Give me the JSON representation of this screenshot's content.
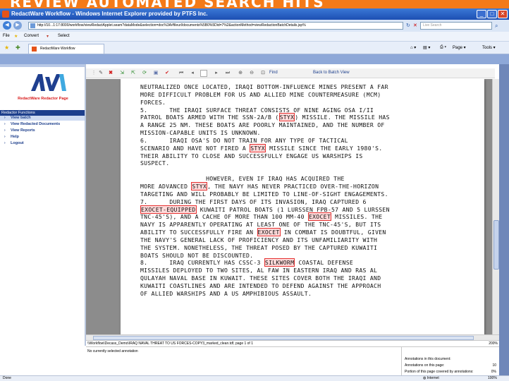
{
  "banner": {
    "text": "REVIEW AUTOMATED SEARCH HITS"
  },
  "window": {
    "title": "RedactWare Workflow - Windows Internet Explorer provided by PTFS Inc."
  },
  "address": {
    "url": "http://10...1:17:8000/workflow/viewRedactApplet.seam?dataMode&selection=doc%3A#fileurl/documents%5B0%5Did=7%2&actionMethod=viewRedactionBatchDetails.jsp%",
    "search_placeholder": "Live Search"
  },
  "menu": {
    "file": "File",
    "star": "★",
    "convert": "Convert",
    "select": "Select"
  },
  "favorites": {
    "tab_label": "RedactWare Workflow",
    "page": "Page",
    "tools": "Tools"
  },
  "sidebar": {
    "brand": "RedactWare Redactor Page",
    "section_title": "Redactor Functions",
    "links": [
      {
        "label": "View batch"
      },
      {
        "label": "View Redacted Documents"
      },
      {
        "label": "View Reports"
      },
      {
        "label": "Help"
      },
      {
        "label": "Logout"
      }
    ]
  },
  "toolbar": {
    "find": "Find",
    "back": "Back to Batch View"
  },
  "document": {
    "lines": [
      [
        {
          "t": "NEUTRALIZED ONCE LOCATED, IRAQI BOTTOM-INFLUENCE MINES PRESENT A FAR"
        }
      ],
      [
        {
          "t": "MORE DIFFICULT PROBLEM FOR US AND ALLIED MINE COUNTERMEASURE (MCM)"
        }
      ],
      [
        {
          "t": "FORCES."
        }
      ],
      [
        {
          "t": "5.      THE IRAQI SURFACE THREAT CONSISTS OF NINE AGING OSA I/II"
        }
      ],
      [
        {
          "t": "PATROL BOATS ARMED WITH THE SSN-2A/B ("
        },
        {
          "t": "STYX",
          "r": 1
        },
        {
          "t": ") MISSILE. THE MISSILE HAS"
        }
      ],
      [
        {
          "t": "A RANGE 25 NM. THESE BOATS ARE POORLY MAINTAINED, AND THE NUMBER OF"
        }
      ],
      [
        {
          "t": "MISSION-CAPABLE UNITS IS UNKNOWN."
        }
      ],
      [
        {
          "t": "6.      IRAQI OSA'S DO NOT TRAIN FOR ANY TYPE OF TACTICAL"
        }
      ],
      [
        {
          "t": "SCENARIO AND HAVE NOT FIRED A "
        },
        {
          "t": "STYX",
          "r": 1
        },
        {
          "t": " MISSILE SINCE THE EARLY 1980'S."
        }
      ],
      [
        {
          "t": "THEIR ABILITY TO CLOSE AND SUCCESSFULLY ENGAGE US WARSHIPS IS"
        }
      ],
      [
        {
          "t": "SUSPECT."
        }
      ],
      [
        {
          "t": ""
        }
      ],
      [
        {
          "t": "                  HOWEVER, EVEN IF IRAQ HAS ACQUIRED THE"
        }
      ],
      [
        {
          "t": "MORE ADVANCED "
        },
        {
          "t": "STYX",
          "r": 1
        },
        {
          "t": ", THE NAVY HAS NEVER PRACTICED OVER-THE-HORIZON"
        }
      ],
      [
        {
          "t": "TARGETING AND WILL PROBABLY BE LIMITED TO LINE-OF-SIGHT ENGAGEMENTS."
        }
      ],
      [
        {
          "t": "7.      DURING THE FIRST DAYS OF ITS INVASION, IRAQ CAPTURED 6"
        }
      ],
      [
        {
          "t": "EXOCET-EQUIPPED",
          "r": 1
        },
        {
          "t": " KUWAITI PATROL BOATS (1 LURSSEN FPB-57 AND 5 LURSSEN"
        }
      ],
      [
        {
          "t": "TNC-45'S), AND A CACHE OF MORE THAN 100 MM-40 "
        },
        {
          "t": "EXOCET",
          "r": 1
        },
        {
          "t": " MISSILES. THE"
        }
      ],
      [
        {
          "t": "NAVY IS APPARENTLY OPERATING AT LEAST ONE OF THE TNC-45'S, BUT ITS"
        }
      ],
      [
        {
          "t": "ABILITY TO SUCCESSFULLY FIRE AN "
        },
        {
          "t": "EXOCET",
          "r": 1
        },
        {
          "t": " IN COMBAT IS DOUBTFUL, GIVEN"
        }
      ],
      [
        {
          "t": "THE NAVY'S GENERAL LACK OF PROFICIENCY AND ITS UNFAMILIARITY WITH"
        }
      ],
      [
        {
          "t": "THE SYSTEM. NONETHELESS, THE THREAT POSED BY THE CAPTURED KUWAITI"
        }
      ],
      [
        {
          "t": "BOATS SHOULD NOT BE DISCOUNTED."
        }
      ],
      [
        {
          "t": "8.      IRAQ CURRENTLY HAS CSSC-3 "
        },
        {
          "t": "SILKWORM",
          "r": 1
        },
        {
          "t": " COASTAL DEFENSE"
        }
      ],
      [
        {
          "t": "MISSILES DEPLOYED TO TWO SITES, AL FAW IN EASTERN IRAQ AND RAS AL"
        }
      ],
      [
        {
          "t": "QULAYAH NAVAL BASE IN KUWAIT. THESE SITES COVER BOTH THE IRAQI AND"
        }
      ],
      [
        {
          "t": "KUWAITI COASTLINES AND ARE INTENDED TO DEFEND AGAINST THE APPROACH"
        }
      ],
      [
        {
          "t": "OF ALLIED WARSHIPS AND A US AMPHIBIOUS ASSAULT."
        }
      ]
    ]
  },
  "viewer": {
    "path": "\\\\Workflow\\Decass_Demo\\IRAQ NAVAL THREAT TO US FORCES-COPY3_marked_clean.tdf, page 1 of 1",
    "zoom": "200%",
    "no_annotation": "No currently selected annotation",
    "stats": [
      {
        "label": "Annotations in this document:",
        "value": ""
      },
      {
        "label": "Annotations on this page:",
        "value": "10"
      },
      {
        "label": "Portion of this page covered by annotations:",
        "value": "0%"
      }
    ]
  },
  "status": {
    "left": "Done",
    "zone": "Internet",
    "zoom": "100%"
  }
}
